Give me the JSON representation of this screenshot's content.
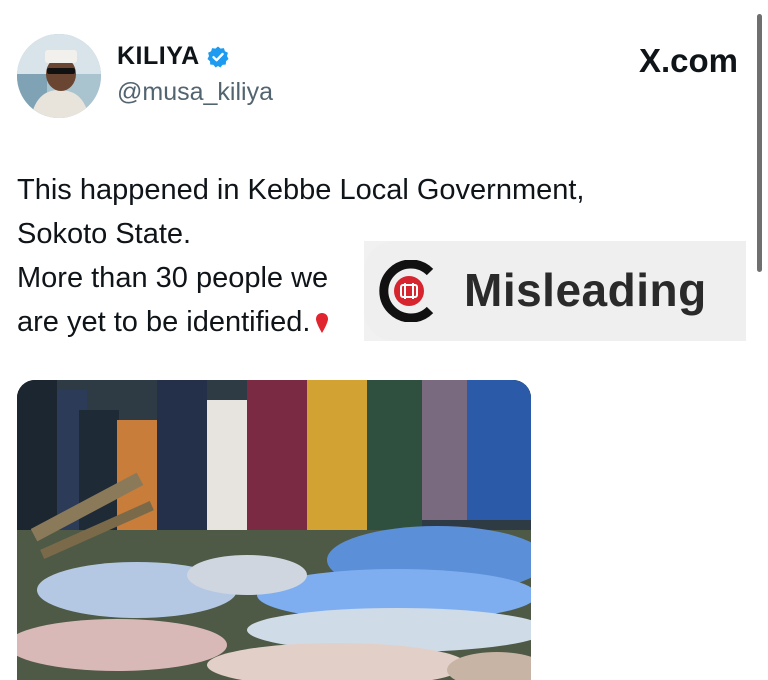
{
  "tweet": {
    "display_name": "KILIYA",
    "handle": "@musa_kiliya",
    "site_label": "X.com",
    "text_lines": [
      "This happened in Kebbe Local Government,",
      "Sokoto State.",
      "More than 30 people we",
      "are yet to be identified."
    ],
    "verified_icon": "verified-badge-icon",
    "emoji_icon": "red-pin-icon"
  },
  "fact_check": {
    "label": "Misleading",
    "logo_icon": "factcheck-logo-icon",
    "label_color": "#2a2a2a",
    "logo_color": "#d6252f"
  },
  "colors": {
    "verified_blue": "#1d9bf0",
    "handle_gray": "#536471"
  }
}
